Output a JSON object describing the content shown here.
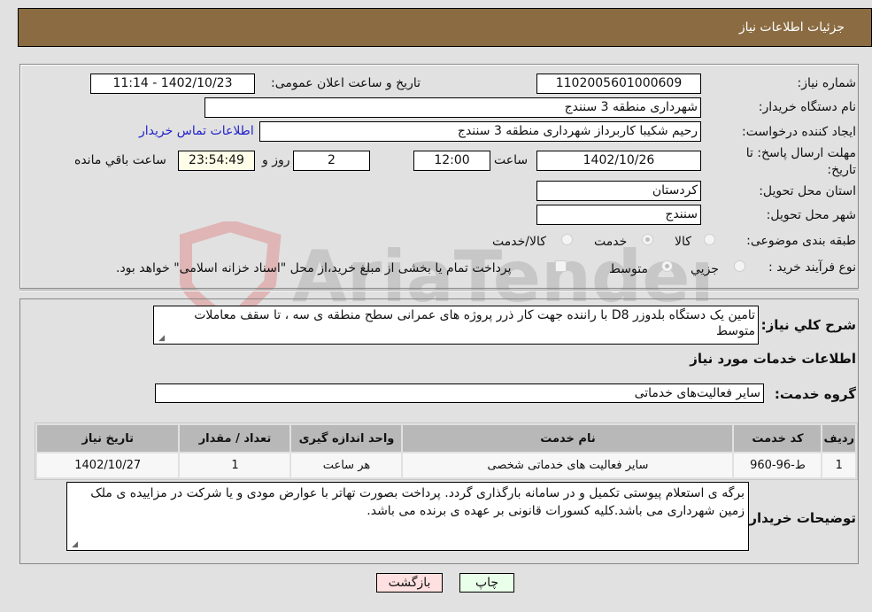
{
  "header": {
    "title": "جزئیات اطلاعات نیاز"
  },
  "fields": {
    "need_number": {
      "label": "شماره نیاز:",
      "value": "1102005601000609"
    },
    "announce_datetime": {
      "label": "تاریخ و ساعت اعلان عمومی:",
      "value": "1402/10/23 - 11:14"
    },
    "buyer_org": {
      "label": "نام دستگاه خریدار:",
      "value": "شهرداری منطقه 3 سنندج"
    },
    "requester": {
      "label": "ایجاد کننده درخواست:",
      "value": "رحیم شکیبا کاربرداز شهرداری منطقه 3 سنندج"
    },
    "buyer_contact_link": "اطلاعات تماس خریدار",
    "deadline": {
      "label": "مهلت ارسال پاسخ: تا تاریخ:",
      "date": "1402/10/26",
      "time_label": "ساعت",
      "time": "12:00",
      "days": "2",
      "days_label": "روز و",
      "remaining": "23:54:49",
      "remaining_label": "ساعت باقي مانده"
    },
    "province": {
      "label": "استان محل تحویل:",
      "value": "کردستان"
    },
    "city": {
      "label": "شهر محل تحویل:",
      "value": "سنندج"
    },
    "category": {
      "label": "طبقه بندی موضوعی:",
      "options": [
        "کالا",
        "خدمت",
        "کالا/خدمت"
      ],
      "selected": "خدمت"
    },
    "purchase_type": {
      "label": "نوع فرآیند خرید :",
      "options": [
        "جزيي",
        "متوسط"
      ],
      "selected": "متوسط",
      "treasury_note": "پرداخت تمام یا بخشی از مبلغ خرید،از محل \"اسناد خزانه اسلامی\" خواهد بود."
    }
  },
  "description": {
    "label": "شرح کلي نیاز:",
    "value": "تامین یک دستگاه بلدوزر D8 با  راننده جهت کار ذرر پروژه های عمرانی سطح منطقه ی سه ، تا سقف معاملات متوسط"
  },
  "services_section_title": "اطلاعات خدمات مورد نیاز",
  "service_group": {
    "label": "گروه خدمت:",
    "value": "سایر فعالیت‌های خدماتی"
  },
  "table": {
    "columns": [
      "ردیف",
      "کد خدمت",
      "نام خدمت",
      "واحد اندازه گیری",
      "تعداد / مقدار",
      "تاریخ نیاز"
    ],
    "rows": [
      [
        "1",
        "ط-96-960",
        "سایر فعالیت های خدماتی شخصی",
        "هر ساعت",
        "1",
        "1402/10/27"
      ]
    ]
  },
  "buyer_notes": {
    "label": "توضیحات خریدار:",
    "value": "برگه ی استعلام پیوستی تکمیل و در سامانه بارگذاری گردد. پرداخت بصورت تهاتر با عوارض مودی و یا شرکت در مزاییده ی ملک  زمین شهرداری می باشد.کلیه کسورات قانونی بر عهده ی برنده می باشد."
  },
  "buttons": {
    "print": "چاپ",
    "back": "بازگشت"
  },
  "watermark": "AriaTender.neT",
  "colors": {
    "header": "#8b6c42",
    "link": "#2222cc",
    "print_btn": "#eaffea",
    "back_btn": "#ffe0e0"
  }
}
